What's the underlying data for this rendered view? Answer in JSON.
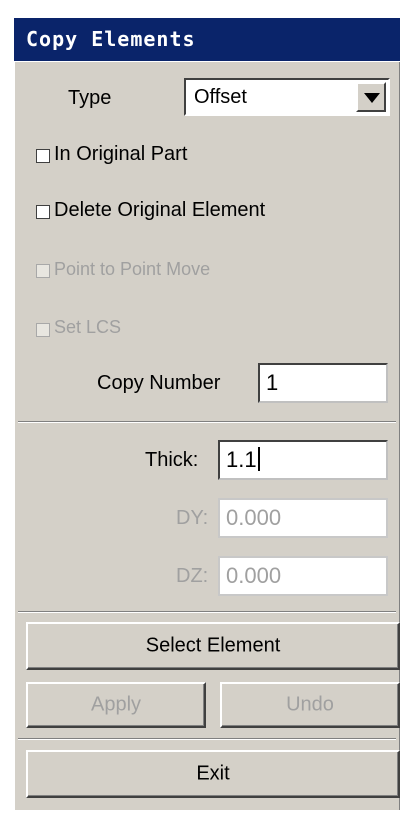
{
  "window": {
    "title": "Copy Elements"
  },
  "type": {
    "label": "Type",
    "value": "Offset"
  },
  "options": [
    {
      "label": "In Original Part",
      "checked": false,
      "enabled": true
    },
    {
      "label": "Delete Original Element",
      "checked": false,
      "enabled": true
    },
    {
      "label": "Point to Point Move",
      "checked": false,
      "enabled": false
    },
    {
      "label": "Set LCS",
      "checked": false,
      "enabled": false
    }
  ],
  "copy_number": {
    "label": "Copy Number",
    "value": "1"
  },
  "thick": {
    "label": "Thick:",
    "value": "1.1"
  },
  "dy": {
    "label": "DY:",
    "value": "0.000"
  },
  "dz": {
    "label": "DZ:",
    "value": "0.000"
  },
  "buttons": {
    "select": "Select Element",
    "apply": "Apply",
    "undo": "Undo",
    "exit": "Exit"
  },
  "colors": {
    "titlebar": "#0a246a",
    "panel": "#d4d0c8",
    "disabled_text": "#a0a0a0"
  }
}
